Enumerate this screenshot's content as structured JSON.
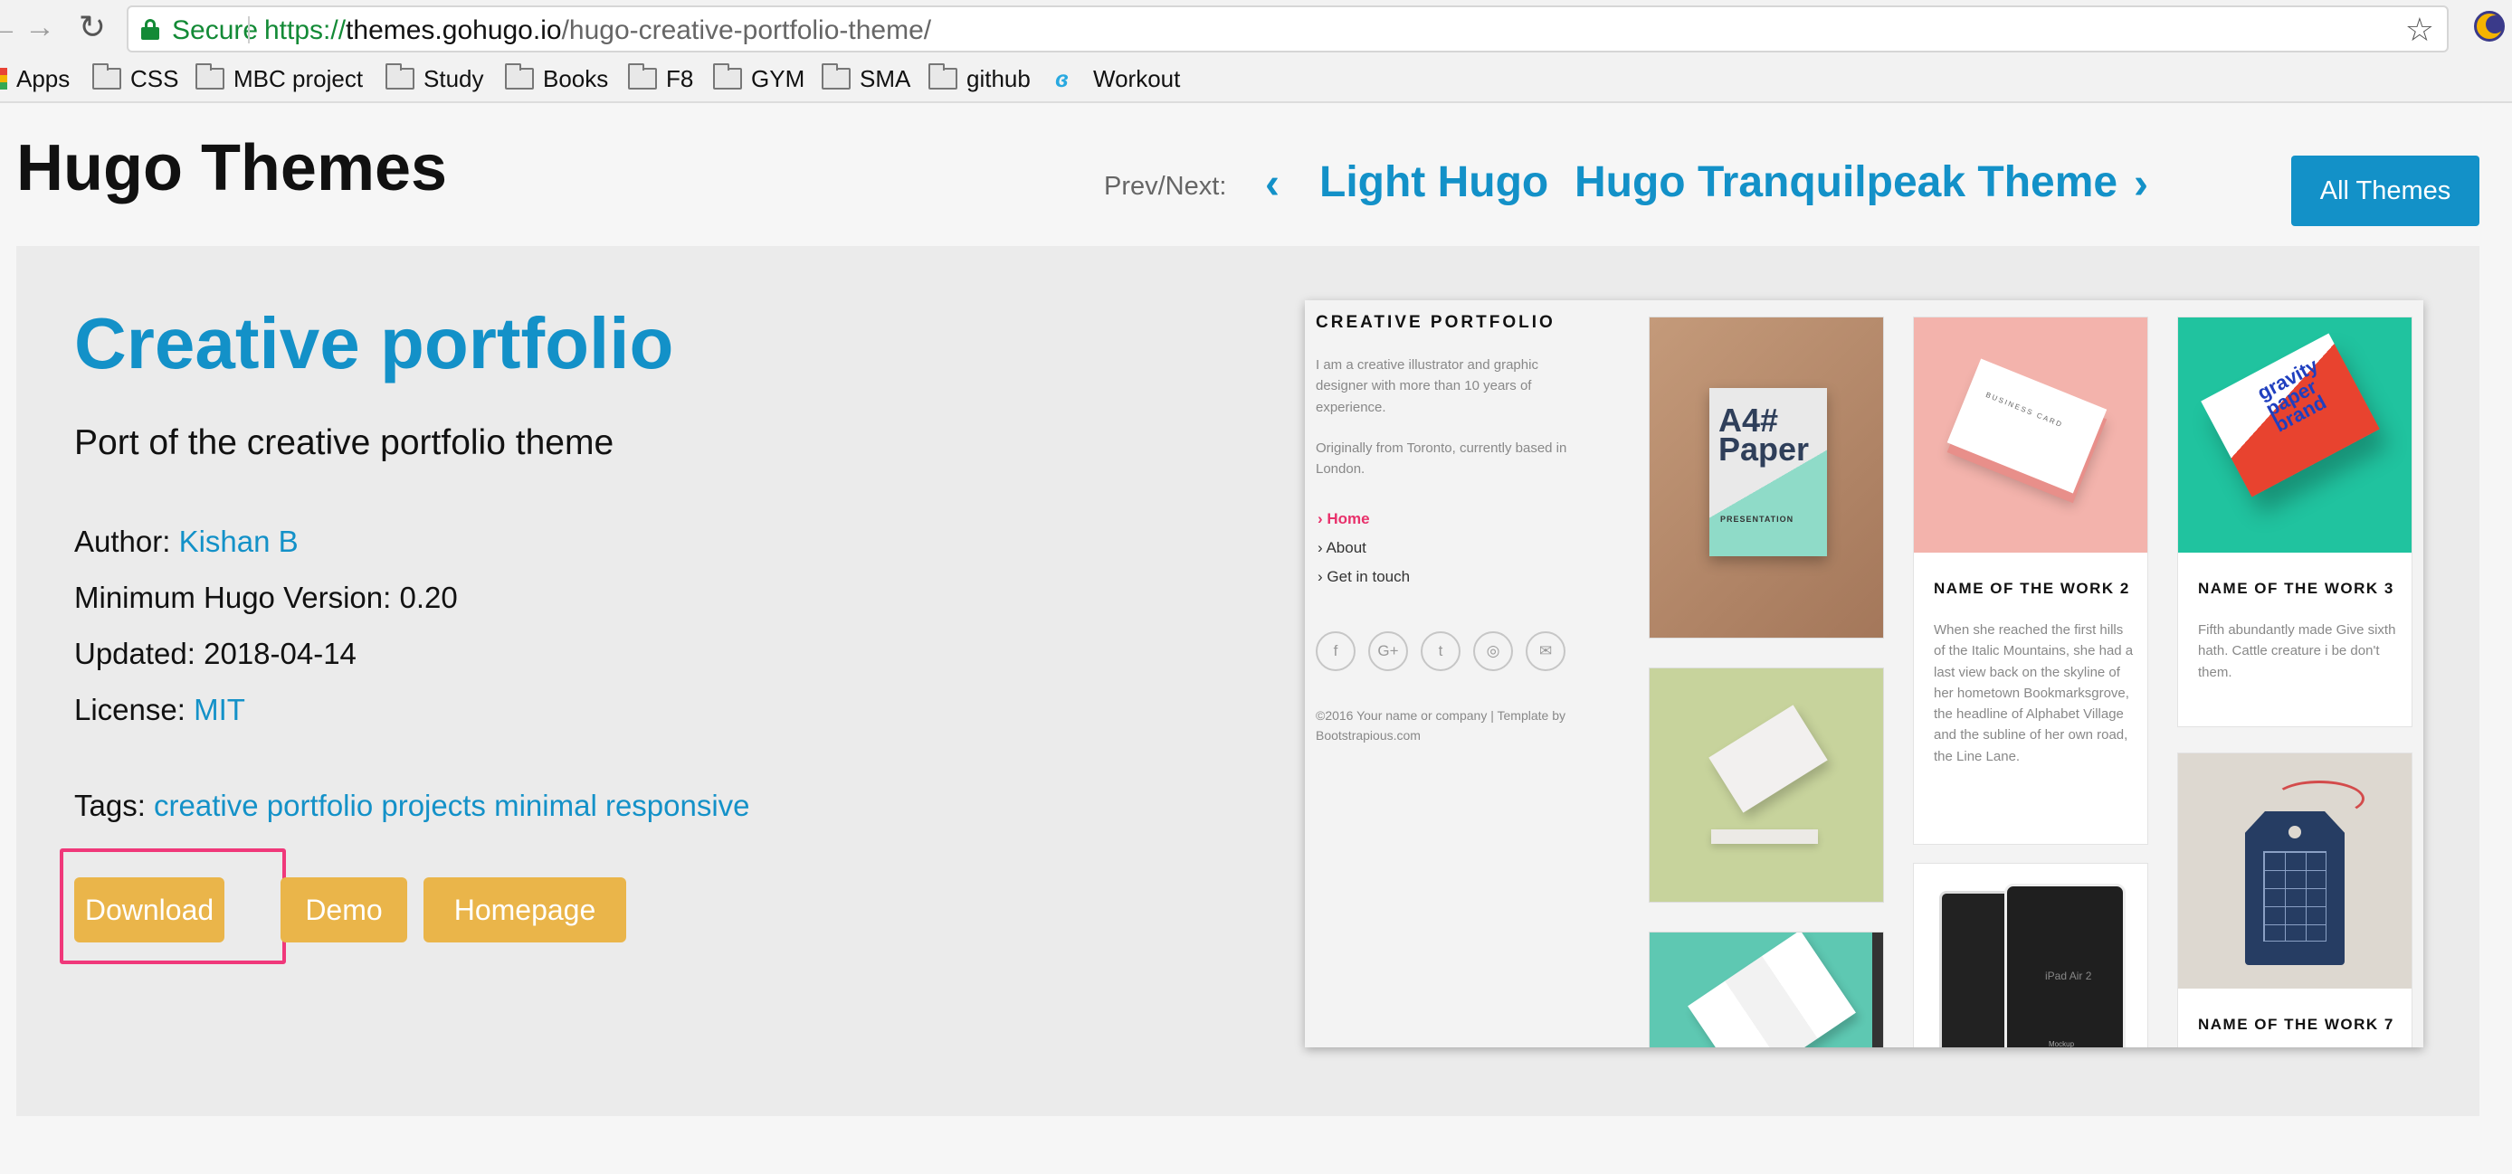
{
  "browser": {
    "secure_label": "Secure",
    "url_scheme": "https://",
    "url_host": "themes.gohugo.io",
    "url_path": "/hugo-creative-portfolio-theme/"
  },
  "bookmarks": {
    "apps": "Apps",
    "items": [
      "CSS",
      "MBC project",
      "Study",
      "Books",
      "F8",
      "GYM",
      "SMA",
      "github"
    ],
    "workout": "Workout"
  },
  "header": {
    "site_title": "Hugo Themes",
    "prevnext_label": "Prev/Next:",
    "prev_theme": "Light Hugo",
    "next_theme": "Hugo Tranquilpeak Theme",
    "all_themes": "All Themes"
  },
  "theme": {
    "title": "Creative portfolio",
    "description": "Port of the creative portfolio theme",
    "author_label": "Author:",
    "author": "Kishan B",
    "min_version_label": "Minimum Hugo Version:",
    "min_version": "0.20",
    "updated_label": "Updated:",
    "updated": "2018-04-14",
    "license_label": "License:",
    "license": "MIT",
    "tags_label": "Tags:",
    "tags": [
      "creative",
      "portfolio",
      "projects",
      "minimal",
      "responsive"
    ],
    "buttons": {
      "download": "Download",
      "demo": "Demo",
      "homepage": "Homepage"
    }
  },
  "preview": {
    "brand": "CREATIVE PORTFOLIO",
    "intro": "I am a creative illustrator and graphic designer with more than 10 years of experience.",
    "origin": "Originally from Toronto, currently based in London.",
    "nav": [
      "Home",
      "About",
      "Get in touch"
    ],
    "social": [
      "f",
      "G+",
      "t",
      "◎",
      "✉"
    ],
    "footer": "©2016 Your name or company | Template by Bootstrapious.com",
    "poster_text": "A4# Paper",
    "poster_sub": "PRESENTATION",
    "bizcard_text": "BUSINESS CARD",
    "flyer_text": "gravity paper brand",
    "ipad_text": "iPad Air 2",
    "ipad_sub": "Mockup",
    "cards": [
      {
        "title": "NAME OF THE WORK 2",
        "desc": "When she reached the first hills of the Italic Mountains, she had a last view back on the skyline of her hometown Bookmarksgrove, the headline of Alphabet Village and the subline of her own road, the Line Lane."
      },
      {
        "title": "NAME OF THE WORK 3",
        "desc": "Fifth abundantly made Give sixth hath. Cattle creature i be don't them."
      },
      {
        "title": "NAME OF THE WORK 7",
        "desc": ""
      }
    ]
  },
  "colors": {
    "accent": "#1391c8",
    "button": "#eab54a",
    "highlight": "#f0387a",
    "secure": "#138a36"
  }
}
